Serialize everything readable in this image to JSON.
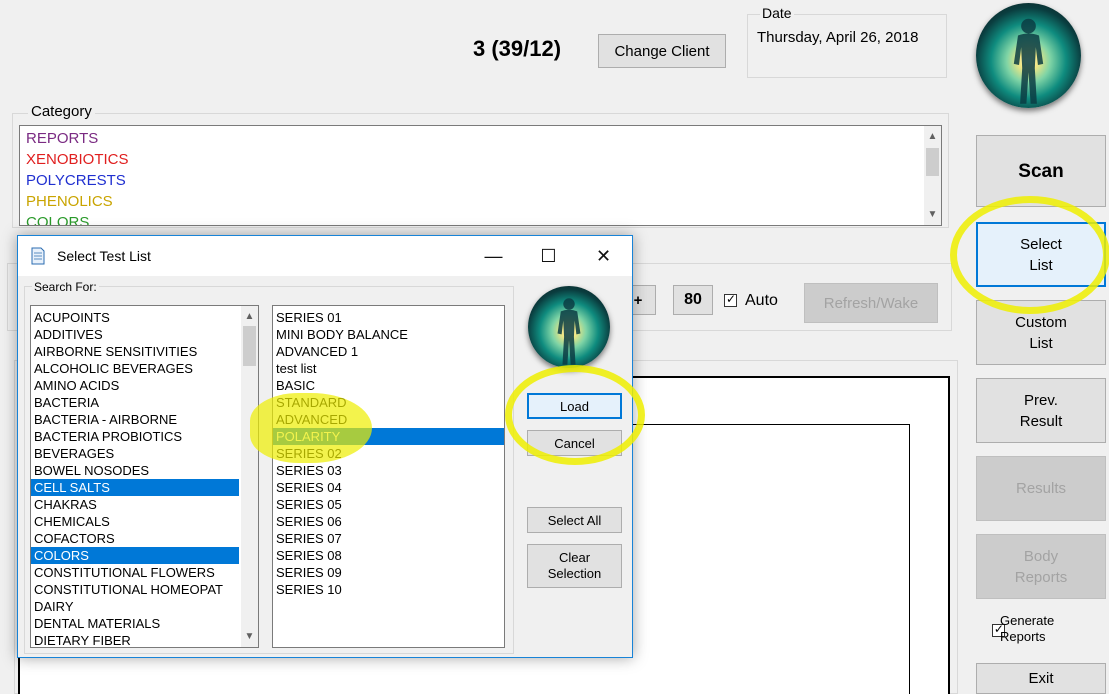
{
  "header": {
    "client_count": "3 (39/12)",
    "change_client_label": "Change Client",
    "date_label": "Date",
    "date_value": "Thursday, April 26, 2018"
  },
  "category": {
    "label": "Category",
    "items": [
      {
        "label": "REPORTS",
        "color": "#7a2a82"
      },
      {
        "label": "XENOBIOTICS",
        "color": "#e01e1e"
      },
      {
        "label": "POLYCRESTS",
        "color": "#2030d0"
      },
      {
        "label": "PHENOLICS",
        "color": "#c9a400"
      },
      {
        "label": "COLORS",
        "color": "#2a9a2a"
      }
    ]
  },
  "sidebar": {
    "scan_label": "Scan",
    "select_list_label": "Select List",
    "custom_list_label": "Custom List",
    "prev_result_label": "Prev. Result",
    "results_label": "Results",
    "body_reports_label": "Body Reports",
    "generate_reports_label": "Generate Reports",
    "generate_reports_checked": true,
    "exit_label": "Exit"
  },
  "controls": {
    "plus_label": "+",
    "level_value": "80",
    "auto_label": "Auto",
    "auto_checked": true,
    "refresh_label": "Refresh/Wake"
  },
  "dialog": {
    "title": "Select Test List",
    "minimize_glyph": "—",
    "maximize_glyph": "☐",
    "close_glyph": "✕",
    "search_label": "Search For:",
    "categories": [
      {
        "label": "ACUPOINTS",
        "selected": false
      },
      {
        "label": "ADDITIVES",
        "selected": false
      },
      {
        "label": "AIRBORNE SENSITIVITIES",
        "selected": false
      },
      {
        "label": "ALCOHOLIC BEVERAGES",
        "selected": false
      },
      {
        "label": "AMINO ACIDS",
        "selected": false
      },
      {
        "label": "BACTERIA",
        "selected": false
      },
      {
        "label": "BACTERIA - AIRBORNE",
        "selected": false
      },
      {
        "label": "BACTERIA PROBIOTICS",
        "selected": false
      },
      {
        "label": "BEVERAGES",
        "selected": false
      },
      {
        "label": "BOWEL NOSODES",
        "selected": false
      },
      {
        "label": "CELL SALTS",
        "selected": true
      },
      {
        "label": "CHAKRAS",
        "selected": false
      },
      {
        "label": "CHEMICALS",
        "selected": false
      },
      {
        "label": "COFACTORS",
        "selected": false
      },
      {
        "label": "COLORS",
        "selected": true
      },
      {
        "label": "CONSTITUTIONAL FLOWERS",
        "selected": false
      },
      {
        "label": "CONSTITUTIONAL HOMEOPAT",
        "selected": false
      },
      {
        "label": "DAIRY",
        "selected": false
      },
      {
        "label": "DENTAL MATERIALS",
        "selected": false
      },
      {
        "label": "DIETARY FIBER",
        "selected": false
      }
    ],
    "series": [
      {
        "label": "SERIES 01",
        "selected": false
      },
      {
        "label": "MINI BODY BALANCE",
        "selected": false
      },
      {
        "label": "ADVANCED 1",
        "selected": false
      },
      {
        "label": "test list",
        "selected": false
      },
      {
        "label": "BASIC",
        "selected": false
      },
      {
        "label": "STANDARD",
        "selected": false
      },
      {
        "label": "ADVANCED",
        "selected": false
      },
      {
        "label": "POLARITY",
        "selected": true
      },
      {
        "label": "SERIES 02",
        "selected": false
      },
      {
        "label": "SERIES 03",
        "selected": false
      },
      {
        "label": "SERIES 04",
        "selected": false
      },
      {
        "label": "SERIES 05",
        "selected": false
      },
      {
        "label": "SERIES 06",
        "selected": false
      },
      {
        "label": "SERIES 07",
        "selected": false
      },
      {
        "label": "SERIES 08",
        "selected": false
      },
      {
        "label": "SERIES 09",
        "selected": false
      },
      {
        "label": "SERIES 10",
        "selected": false
      }
    ],
    "load_label": "Load",
    "cancel_label": "Cancel",
    "select_all_label": "Select All",
    "clear_selection_label": "Clear Selection"
  },
  "icons": {
    "body_avatar": "human-figure-glow-icon",
    "dialog_icon": "document-icon",
    "check": "✓",
    "scroll_up": "▲",
    "scroll_down": "▼"
  },
  "colors": {
    "selection": "#0078d7",
    "highlighter": "#eeee00"
  }
}
